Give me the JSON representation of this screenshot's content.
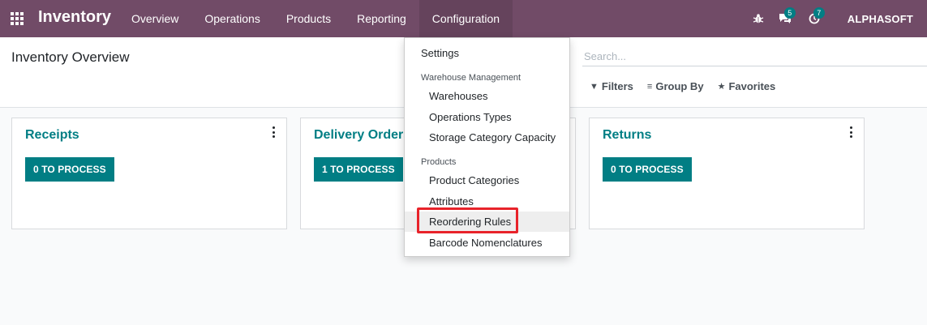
{
  "navbar": {
    "app_title": "Inventory",
    "menu": [
      "Overview",
      "Operations",
      "Products",
      "Reporting",
      "Configuration"
    ],
    "messages_count": "5",
    "activities_count": "7",
    "company": "ALPHASOFT",
    "bg_color": "#714b67"
  },
  "control_panel": {
    "title": "Inventory Overview",
    "search_placeholder": "Search...",
    "filters_label": "Filters",
    "group_by_label": "Group By",
    "favorites_label": "Favorites"
  },
  "cards": [
    {
      "title": "Receipts",
      "button": "0 TO PROCESS"
    },
    {
      "title": "Delivery Orders",
      "button": "1 TO PROCESS"
    },
    {
      "title": "Returns",
      "button": "0 TO PROCESS"
    }
  ],
  "dropdown": {
    "settings": "Settings",
    "section_warehouse": "Warehouse Management",
    "warehouses": "Warehouses",
    "operations_types": "Operations Types",
    "storage_category_capacity": "Storage Category Capacity",
    "section_products": "Products",
    "product_categories": "Product Categories",
    "attributes": "Attributes",
    "reordering_rules": "Reordering Rules",
    "barcode_nomenclatures": "Barcode Nomenclatures"
  },
  "accent_color": "#017e84",
  "highlight_color": "#e8232a"
}
